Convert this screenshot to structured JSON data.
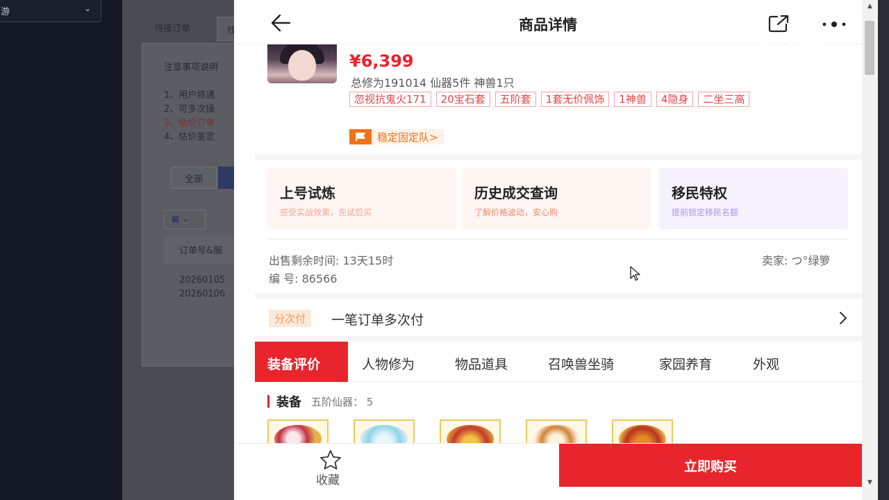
{
  "background": {
    "select_text": "游",
    "tabs": [
      "待接订单",
      "找"
    ],
    "notice_title": "注意事项说明",
    "notice_items": [
      "1、用户将通",
      "2、可多次操",
      "3、估价订单",
      "4、估价鉴定"
    ],
    "filter_all": "全部",
    "table_header": "订单号&服",
    "rows": [
      "20260105",
      "20260106"
    ]
  },
  "header": {
    "title": "商品详情"
  },
  "watermark": "CCTV",
  "product": {
    "price": "¥6,399",
    "stats": "总修为191014  仙器5件  神兽1只",
    "tags": [
      "忽视抗鬼火171",
      "20宝石套",
      "五阶套",
      "1套无价佩饰",
      "1神兽",
      "4隐身",
      "二坐三高"
    ],
    "team_label": "稳定固定队>"
  },
  "features": [
    {
      "title": "上号试炼",
      "subtitle": "感受实战效果，先试后买"
    },
    {
      "title": "历史成交查询",
      "subtitle": "了解价格波动，安心购"
    },
    {
      "title": "移民特权",
      "subtitle": "提前锁定移民名额"
    }
  ],
  "info": {
    "remaining": "出售剩余时间: 13天15时",
    "seller": "卖家: つ°绿箩",
    "serial": "编 号: 86566"
  },
  "installment": {
    "badge": "分次付",
    "text": "一笔订单多次付"
  },
  "tabs": [
    "装备评价",
    "人物修为",
    "物品道具",
    "召唤兽坐骑",
    "家园养育",
    "外观"
  ],
  "equipment": {
    "heading": "装备",
    "sub": "五阶仙器： 5"
  },
  "bottom": {
    "favorite_label": "收藏",
    "buy_label": "立即购买"
  },
  "colors": {
    "accent": "#e8242c",
    "tag_border": "#f3a3a6",
    "team_orange": "#f07219"
  }
}
